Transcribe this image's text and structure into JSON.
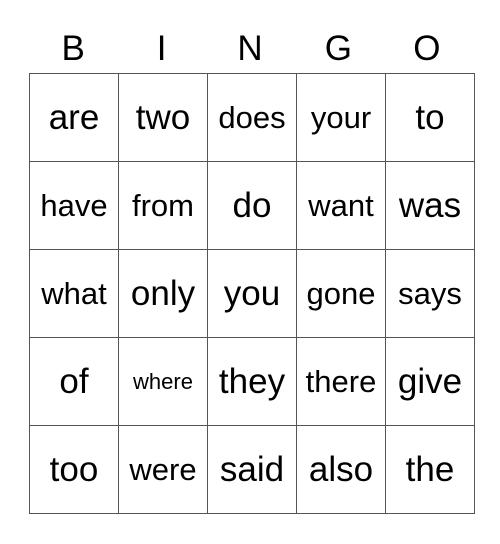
{
  "header": [
    "B",
    "I",
    "N",
    "G",
    "O"
  ],
  "rows": [
    [
      "are",
      "two",
      "does",
      "your",
      "to"
    ],
    [
      "have",
      "from",
      "do",
      "want",
      "was"
    ],
    [
      "what",
      "only",
      "you",
      "gone",
      "says"
    ],
    [
      "of",
      "where",
      "they",
      "there",
      "give"
    ],
    [
      "too",
      "were",
      "said",
      "also",
      "the"
    ]
  ]
}
